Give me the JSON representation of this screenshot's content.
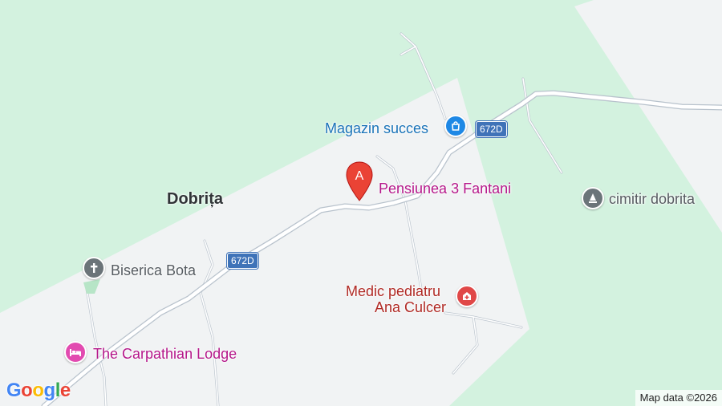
{
  "map": {
    "place": "Dobrița",
    "road_ref": "672D",
    "pois": {
      "shop": {
        "name": "Magazin succes",
        "icon": "shopping-bag-icon",
        "color": "#1e88e5"
      },
      "lodging_selected": {
        "name": "Pensiunea 3 Fantani",
        "marker_letter": "A",
        "icon": "bed-icon",
        "color": "#c2188c"
      },
      "cemetery": {
        "name": "cimitir dobrita",
        "icon": "cemetery-icon",
        "color": "#6b7479"
      },
      "church": {
        "name": "Biserica Bota",
        "icon": "church-cross-icon",
        "color": "#6b7479"
      },
      "doctor": {
        "name_line1": "Medic pediatru",
        "name_line2": "Ana Culcer",
        "icon": "medical-icon",
        "color": "#c5221f"
      },
      "lodge": {
        "name": "The Carpathian Lodge",
        "icon": "bed-icon",
        "color": "#c2188c"
      }
    },
    "colors": {
      "forest": "#d2f1df",
      "landuse": "#f1f3f4",
      "road": "#ffffff",
      "road_edge": "#c4ccd4",
      "marker": "#ea4335"
    }
  },
  "logo": {
    "text": "Google",
    "letters": [
      "G",
      "o",
      "o",
      "g",
      "l",
      "e"
    ],
    "colors": [
      "#4285f4",
      "#ea4335",
      "#fbbc05",
      "#4285f4",
      "#34a853",
      "#ea4335"
    ]
  },
  "attribution": "Map data ©2026"
}
